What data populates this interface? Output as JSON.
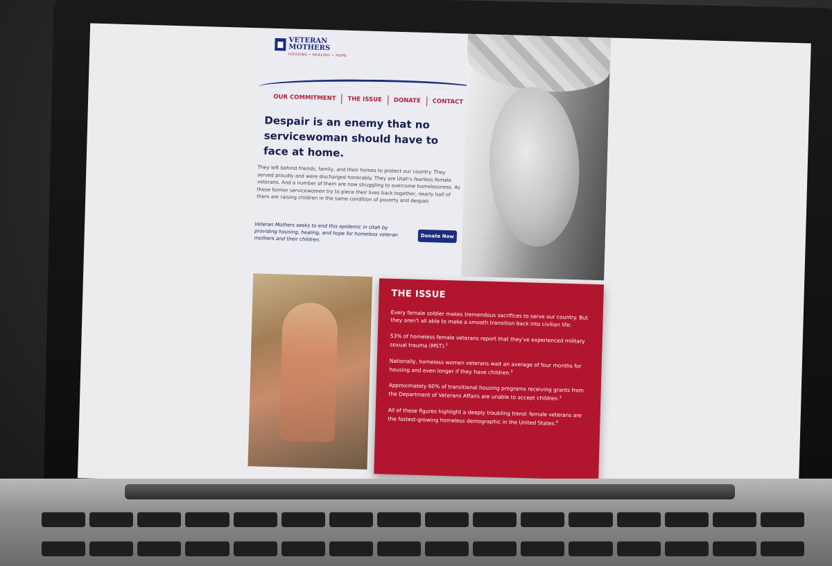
{
  "logo": {
    "line1": "VETERAN",
    "line2": "MOTHERS",
    "tagline": "HOUSING • HEALING • HOPE"
  },
  "nav": {
    "items": [
      {
        "label": "OUR COMMITMENT"
      },
      {
        "label": "THE ISSUE"
      },
      {
        "label": "DONATE"
      },
      {
        "label": "CONTACT"
      }
    ]
  },
  "hero": {
    "headline": "Despair is an enemy that no servicewoman should have to face at home.",
    "body": "They left behind friends, family, and their homes to protect our country. They served proudly and were discharged honorably. They are Utah's fearless female veterans. And a number of them are now struggling to overcome homelessness. As these former servicewomen try to piece their lives back together, nearly half of them are raising children in the same condition of poverty and despair.",
    "mission": "Veteran Mothers seeks to end this epidemic in Utah by providing housing, healing, and hope for homeless veteran mothers and their children.",
    "donate_button": "Donate Now"
  },
  "issue": {
    "title": "THE ISSUE",
    "paragraphs": [
      {
        "text": "Every female soldier makes tremendous sacrifices to serve our country. But they aren't all able to make a smooth transition back into civilian life:",
        "sup": ""
      },
      {
        "text": "53% of homeless female veterans report that they've experienced military sexual trauma (MST).",
        "sup": "1"
      },
      {
        "text": "Nationally, homeless women veterans wait an average of four months for housing and even longer if they have children.",
        "sup": "2"
      },
      {
        "text": "Approximately 60% of transitional housing programs receiving grants from the Department of Veterans Affairs are unable to accept children.",
        "sup": "3"
      },
      {
        "text": "All of these figures highlight a deeply troubling trend: female veterans are the fastest-growing homeless demographic in the United States.",
        "sup": "4"
      }
    ]
  },
  "colors": {
    "navy": "#1c2d7d",
    "red": "#b2162f",
    "hero_bg": "#ebebf2"
  }
}
